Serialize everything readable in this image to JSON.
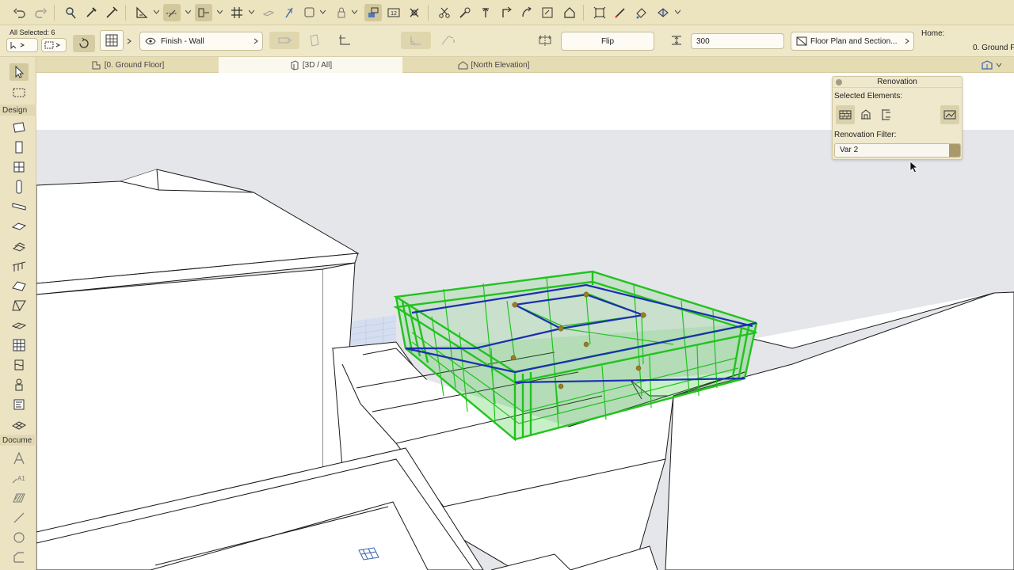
{
  "toolbar": {
    "buttons": [
      {
        "name": "undo-icon"
      },
      {
        "name": "redo-icon"
      },
      {
        "name": "pet-palette-icon"
      },
      {
        "name": "eyedropper-icon"
      },
      {
        "name": "syringe-icon"
      },
      {
        "name": "layer-icon"
      },
      {
        "name": "guide-lines-icon"
      },
      {
        "name": "snap-guide-icon"
      },
      {
        "name": "grid-icon"
      },
      {
        "name": "gravity-icon"
      },
      {
        "name": "box-icon"
      },
      {
        "name": "lock-icon"
      },
      {
        "name": "suspend-groups-icon"
      },
      {
        "name": "detail-12-icon"
      },
      {
        "name": "cross-icon"
      },
      {
        "name": "scissors-icon"
      },
      {
        "name": "adjust-icon"
      },
      {
        "name": "elevate-icon"
      },
      {
        "name": "rotate-icon"
      },
      {
        "name": "offset-icon"
      },
      {
        "name": "crop-icon"
      },
      {
        "name": "home-icon"
      },
      {
        "name": "explode-icon"
      },
      {
        "name": "pen-icon"
      },
      {
        "name": "paint-icon"
      },
      {
        "name": "view-icon"
      }
    ]
  },
  "infobox": {
    "all_selected": "All Selected: 6",
    "layer_label": "Finish - Wall",
    "flip_label": "Flip",
    "height_value": "300",
    "floor_plan_label": "Floor Plan and Section...",
    "home_label": "Home:",
    "home_story": "0. Ground F"
  },
  "tabs": [
    {
      "label": "[0. Ground Floor]",
      "icon": "floor-plan-icon"
    },
    {
      "label": "[3D / All]",
      "icon": "3d-window-icon"
    },
    {
      "label": "[North Elevation]",
      "icon": "elevation-icon"
    }
  ],
  "toolbox": {
    "design_heading": "Design",
    "document_heading": "Docume",
    "tools": [
      "arrow-icon",
      "marquee-icon",
      "wall-icon",
      "door-icon",
      "window-icon",
      "column-icon",
      "beam-icon",
      "slab-icon",
      "stair-icon",
      "railing-icon",
      "roof-icon",
      "shell-icon",
      "morph-icon",
      "curtain-wall-icon",
      "skylight-icon",
      "object-icon",
      "zone-icon",
      "mesh-icon",
      "text-icon",
      "label-icon",
      "fill-icon",
      "line-icon",
      "circle-icon",
      "polyline-icon"
    ]
  },
  "renovation": {
    "title": "Renovation",
    "selected_elements_label": "Selected Elements:",
    "filter_label": "Renovation Filter:",
    "filter_value": "Var 2"
  },
  "colors": {
    "toolbar_bg": "#ece3bf",
    "sky": "#e4e6e9",
    "selection_green": "#22c21f",
    "selection_blue": "#1b2fb0",
    "node": "#a07b20"
  }
}
